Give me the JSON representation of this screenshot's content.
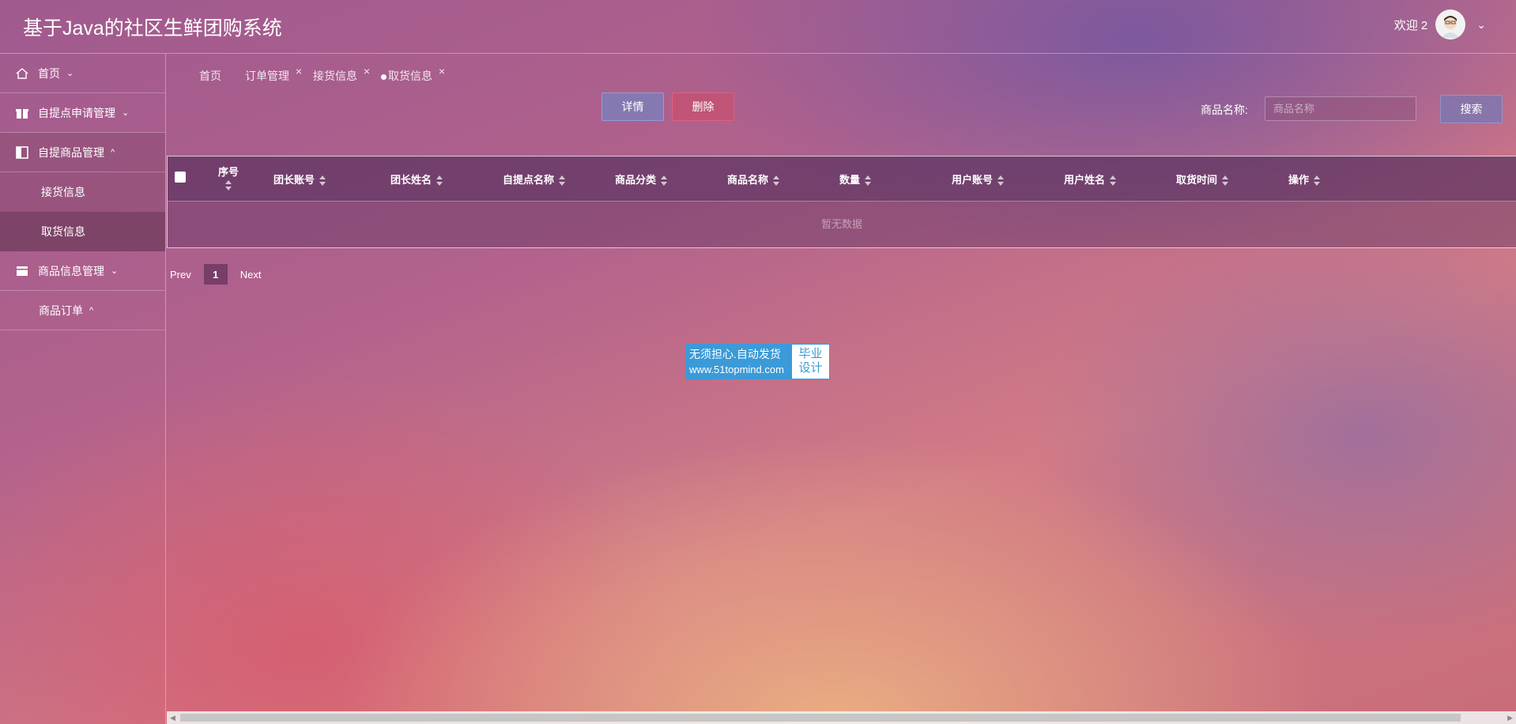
{
  "header": {
    "title": "基于Java的社区生鲜团购系统",
    "welcome": "欢迎 2"
  },
  "sidebar": {
    "items": [
      {
        "label": "首页",
        "arrow": "⌄"
      },
      {
        "label": "自提点申请管理",
        "arrow": "⌄"
      },
      {
        "label": "自提商品管理",
        "arrow": "^"
      },
      {
        "label": "接货信息"
      },
      {
        "label": "取货信息"
      },
      {
        "label": "商品信息管理",
        "arrow": "⌄"
      },
      {
        "label": "商品订单",
        "arrow": "^"
      }
    ]
  },
  "tabs": [
    {
      "label": "首页"
    },
    {
      "label": "订单管理",
      "close": "×"
    },
    {
      "label": "接货信息",
      "close": "×"
    },
    {
      "label": "取货信息",
      "close": "×"
    }
  ],
  "toolbar": {
    "detail_label": "详情",
    "delete_label": "删除",
    "search_label": "商品名称:",
    "search_placeholder": "商品名称",
    "search_button": "搜索"
  },
  "table": {
    "columns": [
      "序号",
      "团长账号",
      "团长姓名",
      "自提点名称",
      "商品分类",
      "商品名称",
      "数量",
      "用户账号",
      "用户姓名",
      "取货时间",
      "操作"
    ],
    "empty_text": "暂无数据"
  },
  "pager": {
    "prev": "Prev",
    "page": "1",
    "next": "Next"
  },
  "watermark": {
    "line1": "无须担心.自动发货",
    "line2": "www.51topmind.com",
    "right1": "毕业",
    "right2": "设计"
  },
  "colors": {
    "watermark_blue": "#3b9ad8"
  }
}
